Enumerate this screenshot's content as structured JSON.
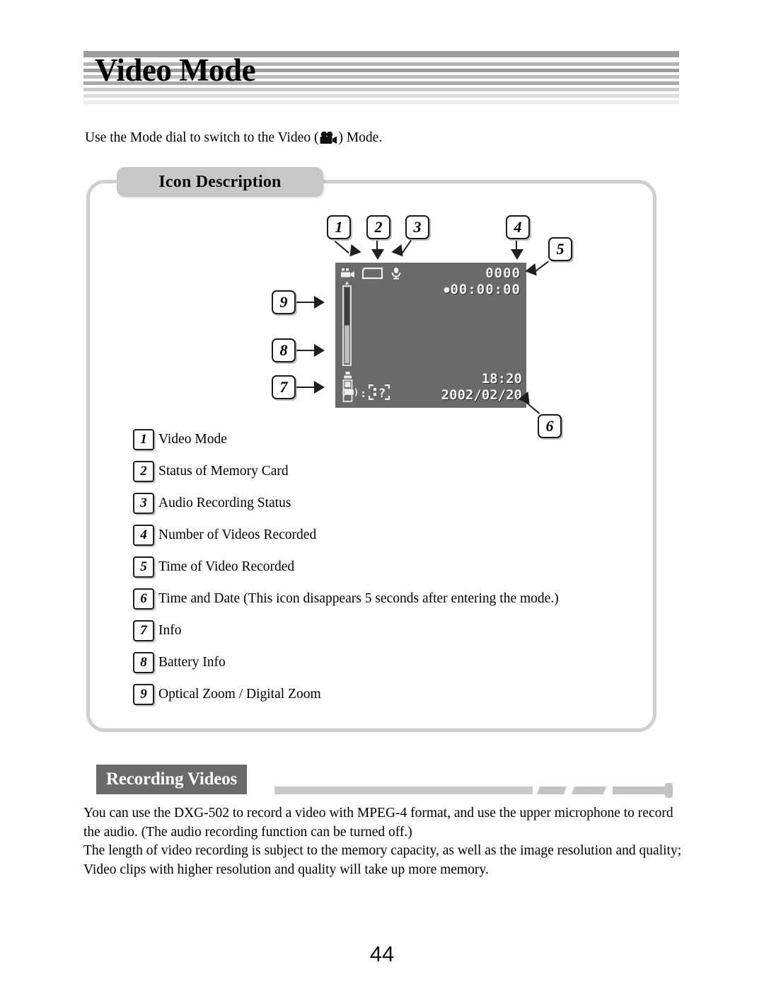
{
  "page": {
    "title": "Video Mode",
    "number": "44"
  },
  "intro": {
    "before_icon": "Use the Mode dial to switch to the Video (",
    "icon": "video-camera-icon",
    "after_icon": ") Mode."
  },
  "icon_description": {
    "tab_label": "Icon Description",
    "callouts": [
      {
        "id": "1",
        "number": "1"
      },
      {
        "id": "2",
        "number": "2"
      },
      {
        "id": "3",
        "number": "3"
      },
      {
        "id": "4",
        "number": "4"
      },
      {
        "id": "5",
        "number": "5"
      },
      {
        "id": "6",
        "number": "6"
      },
      {
        "id": "7",
        "number": "7"
      },
      {
        "id": "8",
        "number": "8"
      },
      {
        "id": "9",
        "number": "9"
      }
    ],
    "lcd": {
      "video_mode_icon": "video-camera-icon",
      "memory_card_icon": "memory-card-icon",
      "microphone_icon": "microphone-icon",
      "video_count": "0000",
      "record_dot": "●",
      "elapsed_time": "00:00:00",
      "clock_time": "18:20",
      "date": "2002/02/20",
      "info_battery_icon": "battery-bracket-icon",
      "info_separator": ":",
      "info_frame_icon": "resolution-frame-question-icon",
      "zoom_bar_icon": "zoom-slider-icon",
      "battery_icon": "battery-level-icon"
    },
    "legend": [
      {
        "number": "1",
        "label": "Video Mode"
      },
      {
        "number": "2",
        "label": "Status of Memory Card"
      },
      {
        "number": "3",
        "label": "Audio Recording Status"
      },
      {
        "number": "4",
        "label": "Number of Videos Recorded"
      },
      {
        "number": "5",
        "label": "Time of Video Recorded"
      },
      {
        "number": "6",
        "label": "Time and Date (This icon disappears 5 seconds after entering the mode.)"
      },
      {
        "number": "7",
        "label": "Info"
      },
      {
        "number": "8",
        "label": "Battery Info"
      },
      {
        "number": "9",
        "label": "Optical Zoom / Digital Zoom"
      }
    ]
  },
  "recording_videos": {
    "heading": "Recording Videos",
    "paragraph_1": "You can use the DXG-502 to record a video with MPEG-4 format, and use the upper microphone to record the audio. (The audio recording function can be turned off.)",
    "paragraph_2": "The length of video recording is subject to the memory capacity, as well as the image resolution and quality; Video clips with higher resolution and quality will take up more memory."
  },
  "colors": {
    "banner_dark": "#9c9c9c",
    "banner_mid": "#c9c9c9",
    "banner_light": "#e4e4e4",
    "lcd_background": "#6a6a6a",
    "section_box": "#6a6a6a",
    "panel_border": "#cfcfcf",
    "tab_background": "#c7c7c7"
  }
}
